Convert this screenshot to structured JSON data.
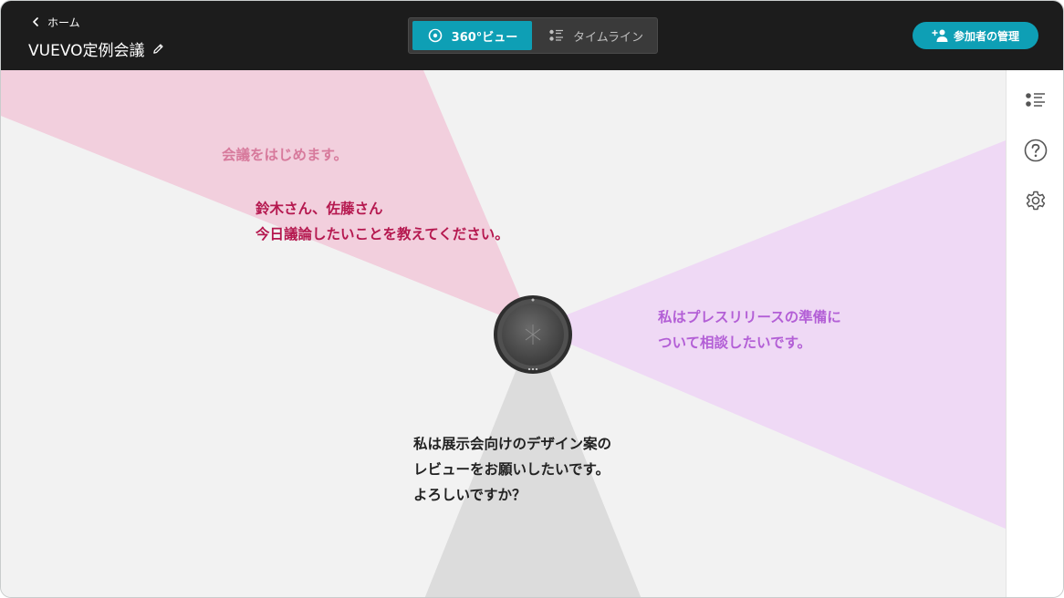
{
  "header": {
    "back_label": "ホーム",
    "title": "VUEVO定例会議",
    "view_tabs": [
      {
        "label": "360°ビュー",
        "icon": "360-view-icon",
        "active": true
      },
      {
        "label": "タイムライン",
        "icon": "timeline-list-icon",
        "active": false
      }
    ],
    "manage_button_label": "参加者の管理"
  },
  "utterances": {
    "speaker_top_left": {
      "color": "#d77a9c",
      "lines": [
        "会議をはじめます。"
      ]
    },
    "speaker_top_left_latest": {
      "color": "#b5184f",
      "lines": [
        "鈴木さん、佐藤さん",
        "今日議論したいことを教えてください。"
      ]
    },
    "speaker_right": {
      "color": "#b35fd6",
      "lines": [
        "私はプレスリリースの準備に",
        "ついて相談したいです。"
      ]
    },
    "speaker_bottom": {
      "color": "#222222",
      "lines": [
        "私は展示会向けのデザイン案の",
        "レビューをお願いしたいです。",
        "よろしいですか？"
      ]
    }
  },
  "sidebar": {
    "icons": [
      "list-view-icon",
      "help-icon",
      "settings-gear-icon"
    ]
  },
  "colors": {
    "accent": "#0e9fb5",
    "header_bg": "#1c1c1c",
    "beam_pink": "#f2cfdd",
    "beam_purple": "#efd9f5",
    "beam_gray": "#dcdcdc"
  }
}
